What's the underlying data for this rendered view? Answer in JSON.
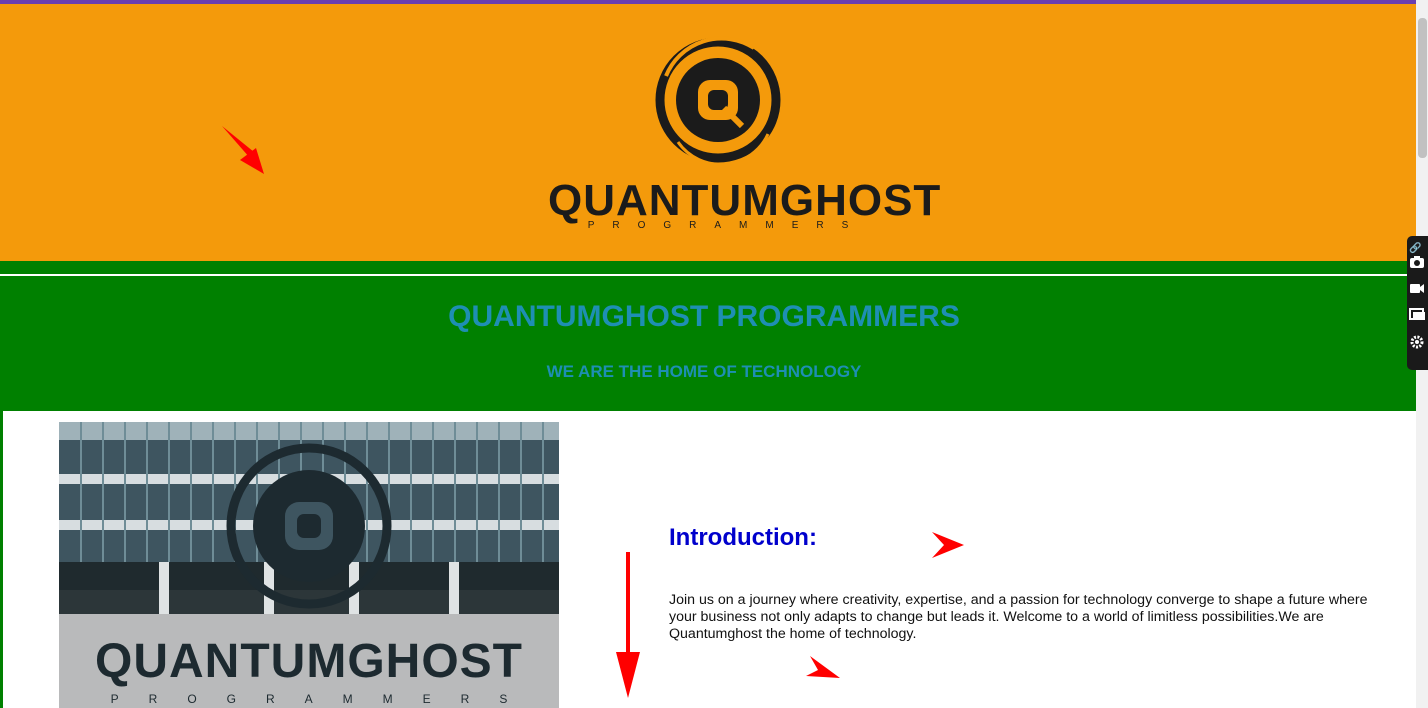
{
  "header": {
    "logo_wordmark": "QUANTUMGHOST",
    "logo_subtitle": "PROGRAMMERS",
    "background": "#f49a0b"
  },
  "banner": {
    "title": "QUANTUMGHOST PROGRAMMERS",
    "tagline": "WE ARE THE HOME OF TECHNOLOGY",
    "background": "#008000",
    "text_color": "#1e8fb3"
  },
  "photo": {
    "wordmark": "QUANTUMGHOST",
    "subtitle": "PROGRAMMERS"
  },
  "intro": {
    "heading": "Introduction:",
    "body": "Join us on a journey where creativity, expertise, and a passion for technology converge to shape a future where your business not only adapts to change but leads it. Welcome to a world of limitless possibilities.We are Quantumghost the home of technology.",
    "heading_color": "#0000cc"
  },
  "toolbar": {
    "items": [
      "link-icon",
      "camera-icon",
      "video-icon",
      "window-icon",
      "gear-icon"
    ]
  },
  "annotations": {
    "arrow_color": "#ff0000"
  }
}
